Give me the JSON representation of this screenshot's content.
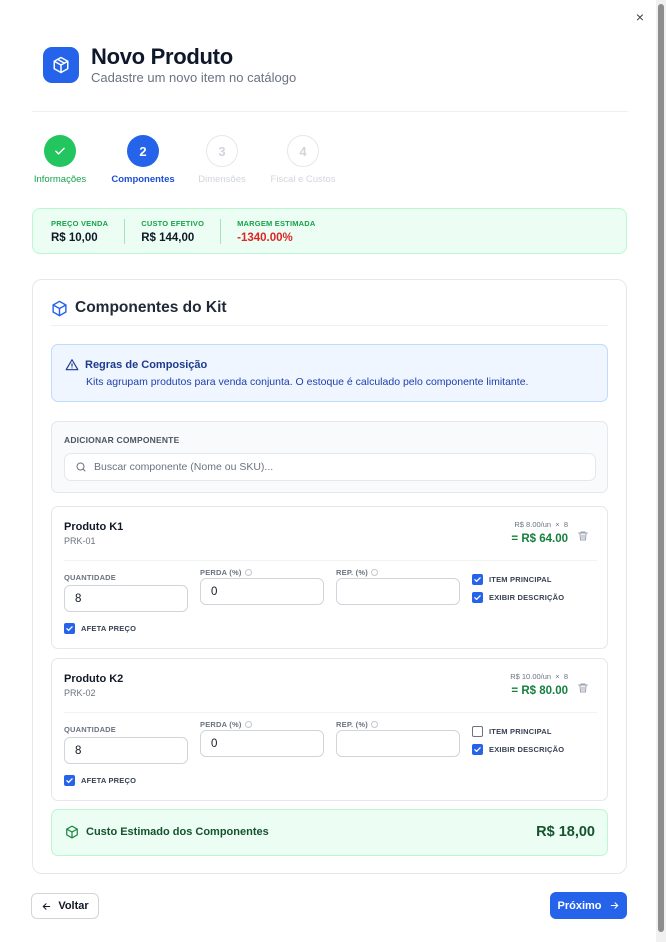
{
  "modal": {
    "close_label": "×"
  },
  "header": {
    "title": "Novo Produto",
    "subtitle": "Cadastre um novo item no catálogo"
  },
  "steps": [
    {
      "number": "1",
      "label": "Informações",
      "state": "done"
    },
    {
      "number": "2",
      "label": "Componentes",
      "state": "active"
    },
    {
      "number": "3",
      "label": "Dimensões",
      "state": "todo"
    },
    {
      "number": "4",
      "label": "Fiscal e Custos",
      "state": "todo"
    }
  ],
  "summary": [
    {
      "label": "PREÇO VENDA",
      "value": "R$ 10,00"
    },
    {
      "label": "CUSTO EFETIVO",
      "value": "R$ 144,00"
    },
    {
      "label": "MARGEM ESTIMADA",
      "value": "-1340.00%"
    }
  ],
  "kit": {
    "title": "Componentes do Kit",
    "rules_title": "Regras de Composição",
    "rules_text": "Kits agrupam produtos para venda conjunta. O estoque é calculado pelo componente limitante.",
    "add_label": "ADICIONAR COMPONENTE",
    "search_placeholder": "Buscar componente (Nome ou SKU)...",
    "fields": {
      "quantity": "QUANTIDADE",
      "loss": "PERDA (%)",
      "rep": "REP. (%)",
      "main_item": "ITEM PRINCIPAL",
      "show_desc": "EXIBIR DESCRIÇÃO",
      "affects_price": "AFETA PREÇO"
    },
    "components": [
      {
        "name": "Produto K1",
        "sku": "PRK-01",
        "unit_price": "R$ 8.00/un",
        "times": "×",
        "qty_display": "8",
        "total": "= R$ 64.00",
        "quantity": "8",
        "loss": "0",
        "rep": "",
        "main_item": true,
        "show_desc": true,
        "affects_price": true
      },
      {
        "name": "Produto K2",
        "sku": "PRK-02",
        "unit_price": "R$ 10.00/un",
        "times": "×",
        "qty_display": "8",
        "total": "= R$ 80.00",
        "quantity": "8",
        "loss": "0",
        "rep": "",
        "main_item": false,
        "show_desc": true,
        "affects_price": true
      }
    ],
    "cost_label": "Custo Estimado dos Componentes",
    "cost_value": "R$ 18,00"
  },
  "footer": {
    "back_label": "Voltar",
    "next_label": "Próximo"
  },
  "colors": {
    "primary": "#2563eb",
    "success": "#22c55e",
    "danger": "#dc2626",
    "success_bg": "#ecfdf3",
    "info_bg": "#eff6ff"
  },
  "icons": {
    "logo": "box-icon",
    "done_step": "check-icon",
    "kit": "package-icon",
    "rules": "warning-icon",
    "search": "search-icon",
    "delete": "trash-icon",
    "back": "arrow-left-icon",
    "next": "arrow-right-icon"
  }
}
